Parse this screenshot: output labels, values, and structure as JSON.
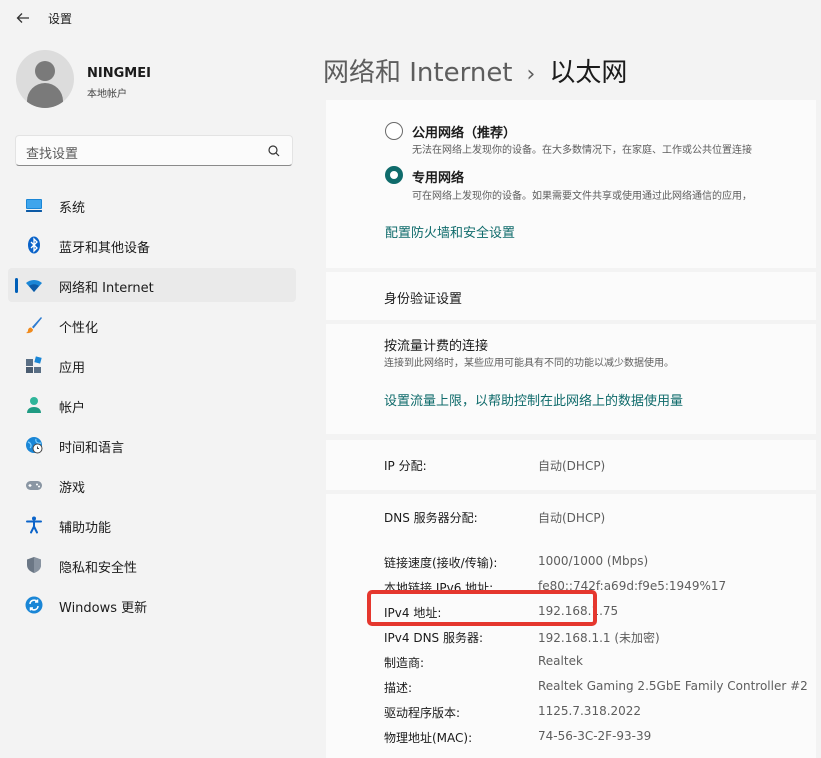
{
  "window": {
    "title": "设置"
  },
  "user": {
    "name": "NINGMEI",
    "account_type": "本地帐户"
  },
  "search": {
    "placeholder": "查找设置"
  },
  "sidebar": {
    "items": [
      {
        "label": "系统"
      },
      {
        "label": "蓝牙和其他设备"
      },
      {
        "label": "网络和 Internet",
        "selected": true
      },
      {
        "label": "个性化"
      },
      {
        "label": "应用"
      },
      {
        "label": "帐户"
      },
      {
        "label": "时间和语言"
      },
      {
        "label": "游戏"
      },
      {
        "label": "辅助功能"
      },
      {
        "label": "隐私和安全性"
      },
      {
        "label": "Windows 更新"
      }
    ]
  },
  "breadcrumb": {
    "parent": "网络和 Internet",
    "separator": "›",
    "current": "以太网"
  },
  "network_profile": {
    "public": {
      "title": "公用网络（推荐）",
      "desc": "无法在网络上发现你的设备。在大多数情况下，在家庭、工作或公共位置连接",
      "selected": false
    },
    "private": {
      "title": "专用网络",
      "desc": "可在网络上发现你的设备。如果需要文件共享或使用通过此网络通信的应用，",
      "selected": true
    },
    "firewall_link": "配置防火墙和安全设置"
  },
  "auth": {
    "label": "身份验证设置"
  },
  "metered": {
    "label": "按流量计费的连接",
    "desc": "连接到此网络时，某些应用可能具有不同的功能以减少数据使用。",
    "link": "设置流量上限，以帮助控制在此网络上的数据使用量"
  },
  "ip_assignment": {
    "label": "IP 分配:",
    "value": "自动(DHCP)"
  },
  "dns_assignment": {
    "label": "DNS 服务器分配:",
    "value": "自动(DHCP)"
  },
  "properties": [
    {
      "label": "链接速度(接收/传输):",
      "value": "1000/1000 (Mbps)"
    },
    {
      "label": "本地链接 IPv6 地址:",
      "value": "fe80::742f:a69d:f9e5:1949%17"
    },
    {
      "label": "IPv4 地址:",
      "value": "192.168.1.75"
    },
    {
      "label": "IPv4 DNS 服务器:",
      "value": "192.168.1.1 (未加密)"
    },
    {
      "label": "制造商:",
      "value": "Realtek"
    },
    {
      "label": "描述:",
      "value": "Realtek Gaming 2.5GbE Family Controller #2"
    },
    {
      "label": "驱动程序版本:",
      "value": "1125.7.318.2022"
    },
    {
      "label": "物理地址(MAC):",
      "value": "74-56-3C-2F-93-39"
    }
  ],
  "colors": {
    "accent": "#0f6b6b",
    "nav_indicator": "#005fb8",
    "highlight": "#e5372e"
  },
  "icons": {
    "back": "back-arrow-icon",
    "search": "search-icon",
    "nav": [
      "system-icon",
      "bluetooth-icon",
      "wifi-icon",
      "brush-icon",
      "apps-icon",
      "account-icon",
      "globe-clock-icon",
      "gamepad-icon",
      "accessibility-icon",
      "shield-icon",
      "windows-update-icon"
    ]
  }
}
